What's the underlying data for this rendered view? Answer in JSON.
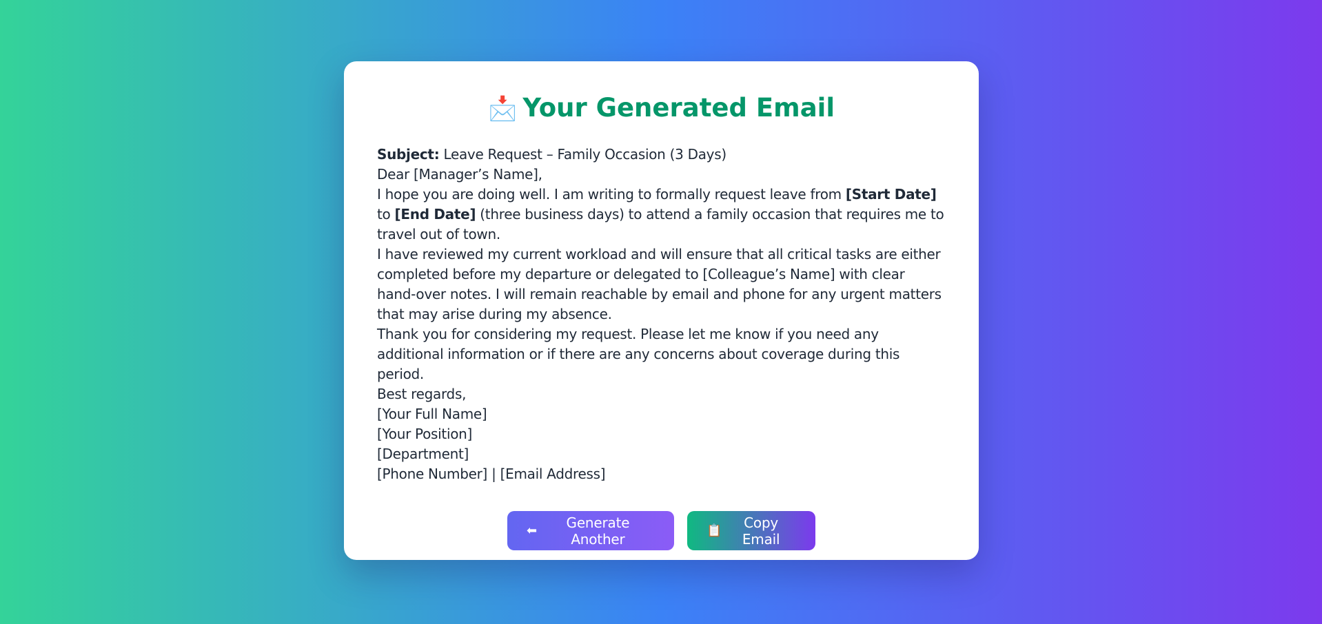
{
  "header": {
    "icon": "inbox-tray-envelope",
    "icon_glyph": "📩",
    "title": "Your Generated Email"
  },
  "email": {
    "subject_label": "Subject:",
    "subject": " Leave Request – Family Occasion (3 Days)",
    "greeting": "Dear [Manager’s Name],",
    "para1_a": "I hope you are doing well. I am writing to formally request leave from ",
    "para1_start": "[Start Date]",
    "para1_b": " to ",
    "para1_end": "[End Date]",
    "para1_c": " (three business days) to attend a family occasion that requires me to travel out of town.",
    "para2": "I have reviewed my current workload and will ensure that all critical tasks are either completed before my departure or delegated to [Colleague’s Name] with clear hand-over notes. I will remain reachable by email and phone for any urgent matters that may arise during my absence.",
    "para3": "Thank you for considering my request. Please let me know if you need any additional information or if there are any concerns about coverage during this period.",
    "closing": "Best regards,",
    "sig_name": "[Your Full Name]",
    "sig_position": "[Your Position]",
    "sig_department": "[Department]",
    "sig_contact": "[Phone Number] | [Email Address]"
  },
  "actions": {
    "generate_icon": "left-arrow",
    "generate_glyph": "⬅",
    "generate_label": "Generate Another",
    "copy_icon": "clipboard",
    "copy_glyph": "📋",
    "copy_label": "Copy Email"
  },
  "colors": {
    "title": "#059669",
    "background_start": "#34d399",
    "background_mid": "#3b82f6",
    "background_end": "#7c3aed"
  }
}
